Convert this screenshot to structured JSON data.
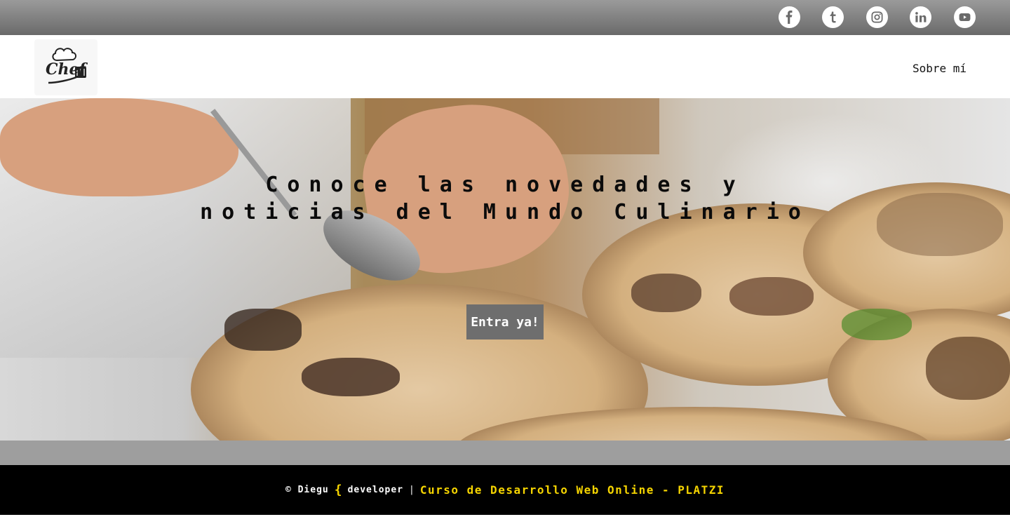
{
  "header": {
    "social_links": [
      {
        "name": "facebook",
        "icon": "facebook-icon"
      },
      {
        "name": "tumblr",
        "icon": "tumblr-icon"
      },
      {
        "name": "instagram",
        "icon": "instagram-icon"
      },
      {
        "name": "linkedin",
        "icon": "linkedin-icon"
      },
      {
        "name": "youtube",
        "icon": "youtube-icon"
      }
    ],
    "logo_text": "Chef",
    "nav": {
      "about_label": "Sobre mí"
    }
  },
  "hero": {
    "title_line1": "Conoce las novedades y",
    "title_line2": "noticias del Mundo Culinario",
    "cta_label": "Entra ya!",
    "image_icon": "chef-plating-food-photo"
  },
  "footer": {
    "copyright": "© Diegu",
    "brace": "{",
    "developer": "developer",
    "separator": "|",
    "course": "Curso de Desarrollo Web Online - PLATZI"
  },
  "colors": {
    "topbar": "#7a7a7a",
    "footer_bg": "#000000",
    "accent_yellow": "#f5d400",
    "band": "#9e9e9e",
    "cta_bg": "#6e6e6e"
  }
}
